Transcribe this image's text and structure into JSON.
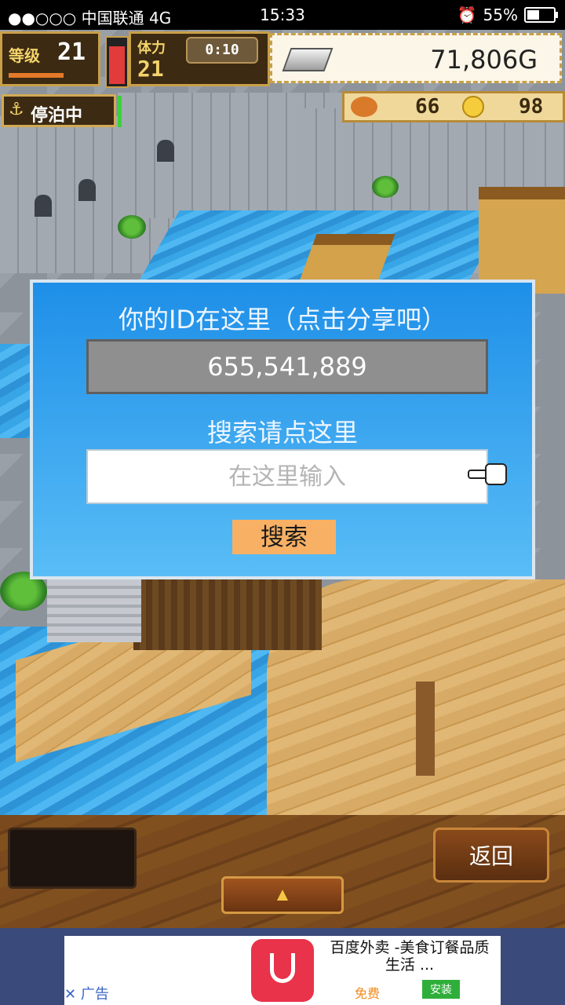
{
  "status_bar": {
    "carrier": "●●○○○ 中国联通 4G",
    "time": "15:33",
    "battery": "55%",
    "battery_level": 0.55
  },
  "hud": {
    "level_label": "等级",
    "level_value": "21",
    "stamina_label": "体力",
    "stamina_value": "21",
    "timer": "0:10",
    "gold": "71,806G",
    "docked_label": "停泊中",
    "food_value": "66",
    "coin_value": "98"
  },
  "dialog": {
    "title": "你的ID在这里（点击分享吧）",
    "player_id": "655,541,889",
    "search_label": "搜索请点这里",
    "search_placeholder": "在这里输入",
    "search_button": "搜索"
  },
  "bottom_bar": {
    "back_button": "返回",
    "expand_arrow": "▲"
  },
  "ad": {
    "close_label": "✕",
    "ad_label": "广告",
    "app_title": "百度外卖 -美食订餐品质生活 ...",
    "price": "免费",
    "install_button": "安装"
  },
  "colors": {
    "dialog_top": "#1e8fe8",
    "dialog_bottom": "#59bdf6",
    "search_button": "#f7b064"
  }
}
